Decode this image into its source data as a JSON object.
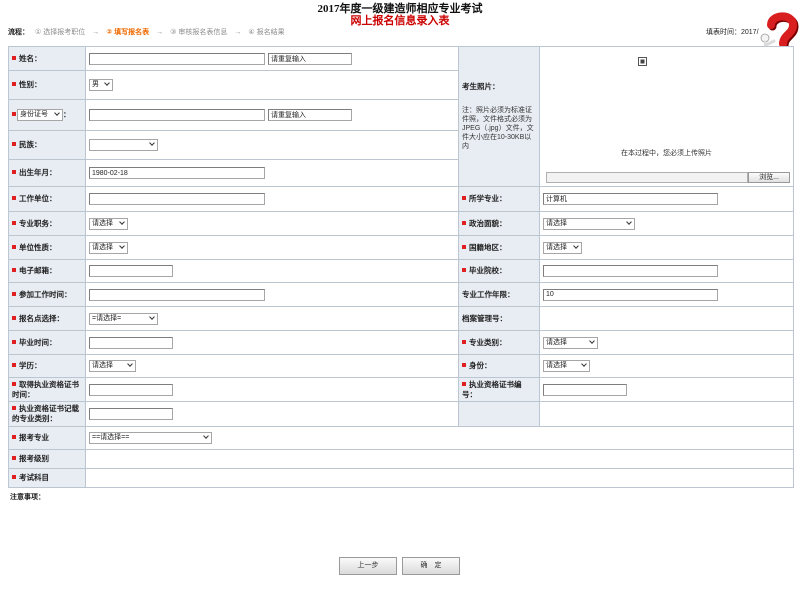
{
  "header": {
    "title_line1": "2017年度一级建造师相应专业考试",
    "title_line2": "网上报名信息录入表",
    "fill_time": "填表时间：2017/"
  },
  "steps": {
    "label": "流程：",
    "arrow": "→",
    "items": [
      {
        "text": "① 选择报考职位",
        "current": false
      },
      {
        "text": "② 填写报名表",
        "current": true
      },
      {
        "text": "③ 审核报名表信息",
        "current": false
      },
      {
        "text": "④ 报名结果",
        "current": false
      }
    ]
  },
  "form": {
    "name": {
      "label": "姓名：",
      "value": "",
      "repeat_value": "请重复输入",
      "required": true
    },
    "gender": {
      "label": "性别：",
      "value": "男",
      "required": true
    },
    "id": {
      "type": "身份证号",
      "suffix": "：",
      "value": "",
      "repeat_value": "请重复输入",
      "required": true
    },
    "ethnicity": {
      "label": "民族：",
      "value": "",
      "required": true
    },
    "birth": {
      "label": "出生年月：",
      "value": "1980-02-18",
      "required": true
    },
    "photo": {
      "label": "考生照片：",
      "note": "注：照片必须为标准证件照，文件格式必须为JPEG（.jpg）文件，文件大小应在10-30KB以内",
      "hint": "在本过程中，您必须上传照片",
      "browse_label": "浏览..."
    },
    "workplace": {
      "label": "工作单位：",
      "value": "",
      "required": true
    },
    "major": {
      "label": "所学专业：",
      "value": "计算机",
      "required": true
    },
    "job_title": {
      "label": "专业职务：",
      "value": "请选择",
      "required": true
    },
    "politics": {
      "label": "政治面貌：",
      "value": "请选择",
      "required": true
    },
    "unit_type": {
      "label": "单位性质：",
      "value": "请选择",
      "required": true
    },
    "region": {
      "label": "国籍地区：",
      "value": "请选择",
      "required": true
    },
    "email": {
      "label": "电子邮箱：",
      "value": "",
      "required": true
    },
    "school": {
      "label": "毕业院校：",
      "value": "",
      "required": true
    },
    "work_start": {
      "label": "参加工作时间：",
      "value": "",
      "required": true
    },
    "work_years": {
      "label": "专业工作年限：",
      "value": "10",
      "required": false
    },
    "exam_site": {
      "label": "报名点选择：",
      "value": "=请选择=",
      "required": true
    },
    "archive_no": {
      "label": "档案管理号：",
      "required": false
    },
    "grad_time": {
      "label": "毕业时间：",
      "value": "",
      "required": true
    },
    "major_category": {
      "label": "专业类别：",
      "value": "请选择",
      "required": true
    },
    "education": {
      "label": "学历：",
      "value": "请选择",
      "required": true
    },
    "identity": {
      "label": "身份：",
      "value": "请选择",
      "required": true
    },
    "cert_time": {
      "label": "取得执业资格证书时间：",
      "value": "",
      "required": true
    },
    "cert_no": {
      "label": "执业资格证书编号：",
      "value": "",
      "required": true
    },
    "cert_major": {
      "label": "执业资格证书记载的专业类别：",
      "value": "",
      "required": true
    },
    "exam_major": {
      "label": "报考专业",
      "value": "==请选择==",
      "required": true
    },
    "exam_level": {
      "label": "报考级别",
      "required": true
    },
    "exam_subjects": {
      "label": "考试科目",
      "required": true
    }
  },
  "notes": {
    "label": "注意事项："
  },
  "buttons": {
    "prev": "上一步",
    "confirm": "确　定"
  },
  "icons": {
    "help": "help-question-icon",
    "photo": "photo-placeholder-icon",
    "required": "required-marker",
    "dropdown": "chevron-down-icon"
  },
  "colors": {
    "title_red": "#cc0000",
    "step_current": "#f06a00",
    "step_other": "#8c8c8c",
    "label_bg": "#e8edf3",
    "border": "#bcc6d0",
    "required_marker": "#e02020"
  }
}
